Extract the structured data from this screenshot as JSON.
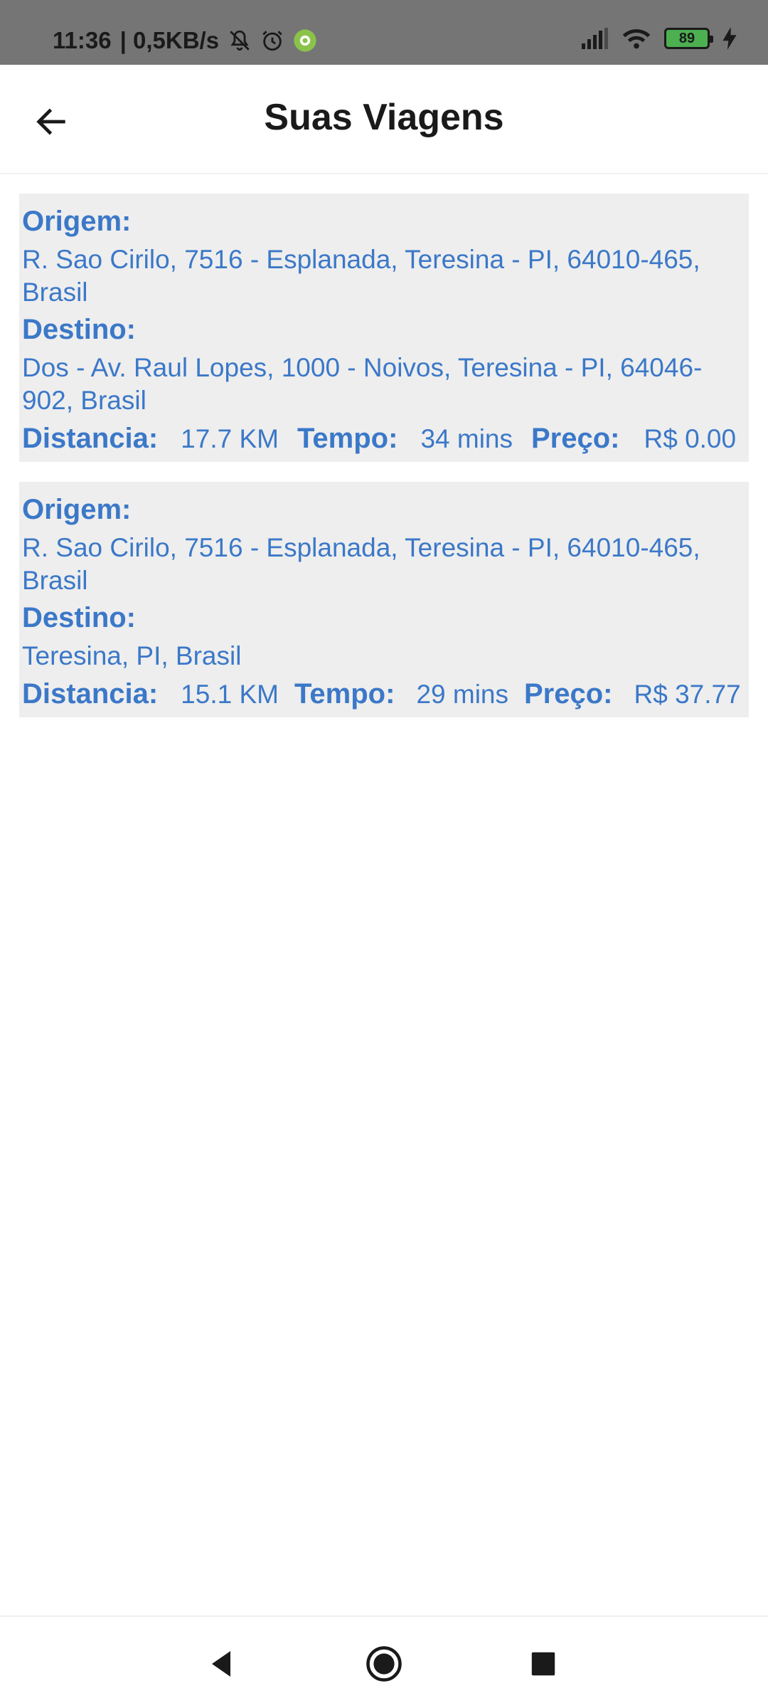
{
  "status_bar": {
    "time": "11:36",
    "network_speed": "| 0,5KB/s",
    "battery_level": "89",
    "icons": [
      "muted-bell-icon",
      "alarm-icon",
      "app-notification-icon",
      "signal-icon",
      "wifi-icon",
      "battery-icon",
      "charging-icon"
    ]
  },
  "app_bar": {
    "title": "Suas Viagens",
    "back_icon": "arrow-left-icon"
  },
  "labels": {
    "origin": "Origem:",
    "destination": "Destino:",
    "distance": "Distancia:",
    "time": "Tempo:",
    "price": "Preço:"
  },
  "trips": [
    {
      "origin": "R. Sao Cirilo, 7516 - Esplanada, Teresina - PI, 64010-465, Brasil",
      "destination": "Dos - Av. Raul Lopes, 1000 - Noivos, Teresina - PI, 64046-902, Brasil",
      "distance": "17.7 KM",
      "time": "34 mins",
      "price": "R$ 0.00"
    },
    {
      "origin": "R. Sao Cirilo, 7516 - Esplanada, Teresina - PI, 64010-465, Brasil",
      "destination": "Teresina, PI, Brasil",
      "distance": "15.1 KM",
      "time": "29 mins",
      "price": "R$ 37.77"
    }
  ],
  "colors": {
    "accent": "#3b78c8",
    "card_background": "#eeeeee",
    "status_bar": "#757575"
  },
  "nav_bar": {
    "icons": [
      "back-triangle-icon",
      "home-circle-icon",
      "recents-square-icon"
    ]
  }
}
